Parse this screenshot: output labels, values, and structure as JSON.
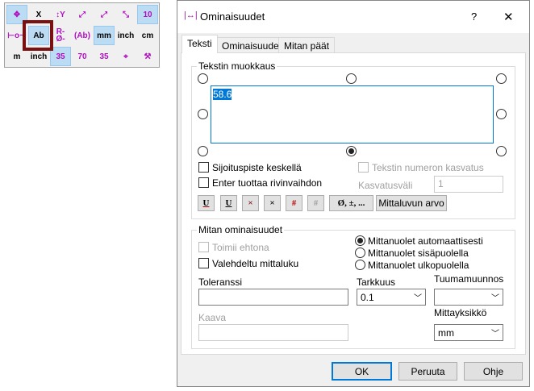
{
  "toolbar": {
    "cells": [
      [
        "✥",
        "X",
        "↕Y",
        "⤢",
        "⤢",
        "⤡",
        "10"
      ],
      [
        "⊢o⊣",
        "Ab",
        "R-\nØ-",
        "(Ab)",
        "mm",
        "inch",
        "cm"
      ],
      [
        "m",
        "inch",
        "35",
        "70",
        "35",
        "⌖",
        "⚒"
      ]
    ]
  },
  "dialog": {
    "title": "Ominaisuudet",
    "help": "?",
    "close": "✕",
    "title_icon": "dimension-icon",
    "tabs": [
      "Teksti",
      "Ominaisuudet",
      "Mitan päät"
    ],
    "text_group": {
      "label": "Tekstin muokkaus",
      "text_value": "58.6",
      "center_anchor": "Sijoituspiste keskellä",
      "enter_newline": "Enter tuottaa rivinvaihdon",
      "number_increment": "Tekstin numeron kasvatus",
      "increment_label": "Kasvatusväli",
      "increment_value": "1",
      "buttons": [
        "U",
        "U",
        "×",
        "×",
        "#",
        "#"
      ],
      "symbols": "Ø, ±, ...",
      "dim_value": "Mittaluvun arvo"
    },
    "dim_group": {
      "label": "Mitan ominaisuudet",
      "acts_as_condition": "Toimii ehtona",
      "fake_value": "Valehdeltu mittaluku",
      "arrows": [
        "Mittanuolet automaattisesti",
        "Mittanuolet sisäpuolella",
        "Mittanuolet ulkopuolella"
      ],
      "tolerance": "Toleranssi",
      "tolerance_value": "",
      "formula": "Kaava",
      "formula_value": "",
      "precision": "Tarkkuus",
      "precision_value": "0.1",
      "inch_conv": "Tuumamuunnos",
      "inch_conv_value": "",
      "unit": "Mittayksikkö",
      "unit_value": "mm"
    },
    "ok": "OK",
    "cancel": "Peruuta",
    "help_button": "Ohje"
  }
}
